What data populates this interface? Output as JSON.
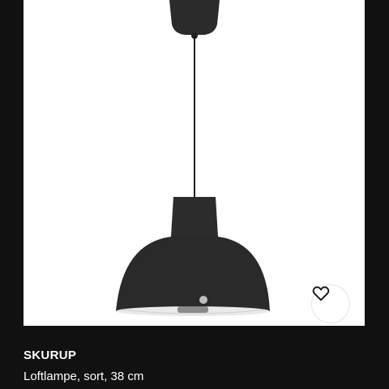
{
  "product": {
    "name": "SKURUP",
    "description": "Loftlampe, sort, 38 cm",
    "image_icon": "pendant-lamp-image",
    "favorite_icon": "heart-outline-icon"
  },
  "colors": {
    "background": "#111111",
    "image_background": "#ffffff",
    "lamp": "#2a2a2a",
    "text": "#ffffff"
  }
}
